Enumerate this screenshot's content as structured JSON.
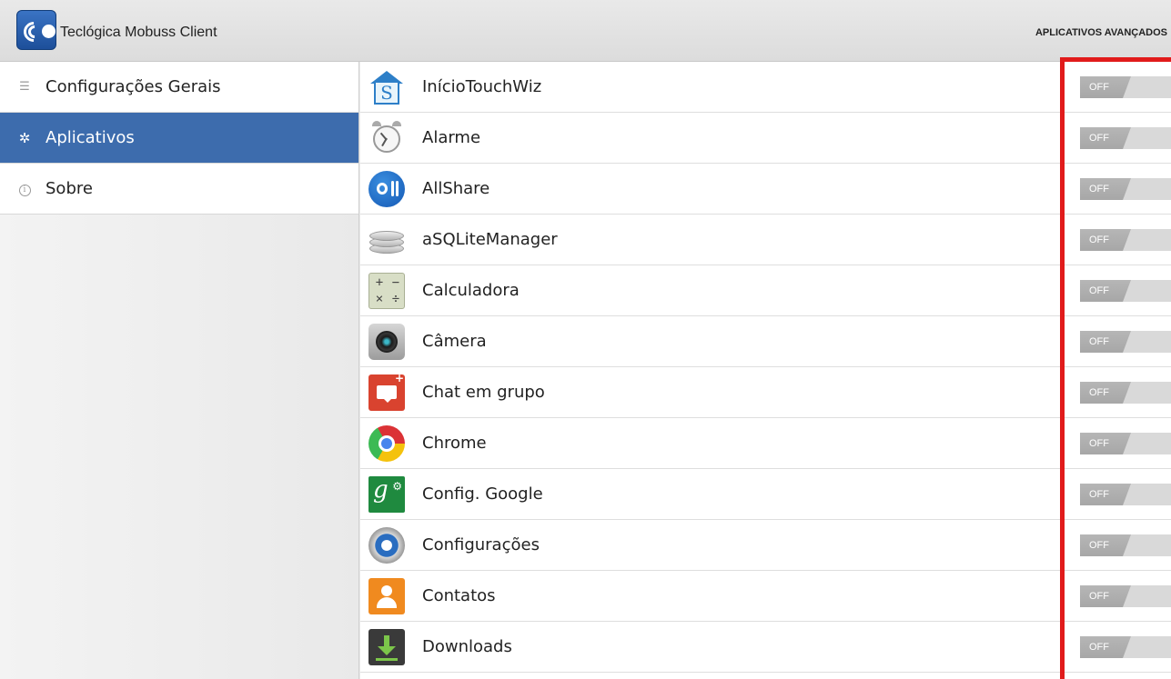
{
  "actionbar": {
    "title": "Teclógica Mobuss Client",
    "action_label": "APLICATIVOS AVANÇADOS",
    "app_icon": "mobuss-logo-icon"
  },
  "sidebar": {
    "items": [
      {
        "label": "Configurações Gerais",
        "icon": "menu-lines-icon",
        "active": false
      },
      {
        "label": "Aplicativos",
        "icon": "gear-icon",
        "active": true
      },
      {
        "label": "Sobre",
        "icon": "info-icon",
        "active": false
      }
    ]
  },
  "apps": {
    "rows": [
      {
        "label": "InícioTouchWiz",
        "icon": "touchwiz-home-icon",
        "state": "OFF"
      },
      {
        "label": "Alarme",
        "icon": "alarm-clock-icon",
        "state": "OFF"
      },
      {
        "label": "AllShare",
        "icon": "allshare-icon",
        "state": "OFF"
      },
      {
        "label": "aSQLiteManager",
        "icon": "database-icon",
        "state": "OFF"
      },
      {
        "label": "Calculadora",
        "icon": "calculator-icon",
        "state": "OFF"
      },
      {
        "label": "Câmera",
        "icon": "camera-icon",
        "state": "OFF"
      },
      {
        "label": "Chat em grupo",
        "icon": "group-chat-icon",
        "state": "OFF"
      },
      {
        "label": "Chrome",
        "icon": "chrome-icon",
        "state": "OFF"
      },
      {
        "label": "Config. Google",
        "icon": "google-settings-icon",
        "state": "OFF"
      },
      {
        "label": "Configurações",
        "icon": "settings-icon",
        "state": "OFF"
      },
      {
        "label": "Contatos",
        "icon": "contacts-icon",
        "state": "OFF"
      },
      {
        "label": "Downloads",
        "icon": "downloads-icon",
        "state": "OFF"
      }
    ]
  },
  "calculator_glyphs": [
    "+",
    "−",
    "×",
    "÷"
  ],
  "google_glyph": "g",
  "colors": {
    "accent": "#3d6cad",
    "highlight": "#e11b1b",
    "toggle_off": "#b0b0b0"
  }
}
